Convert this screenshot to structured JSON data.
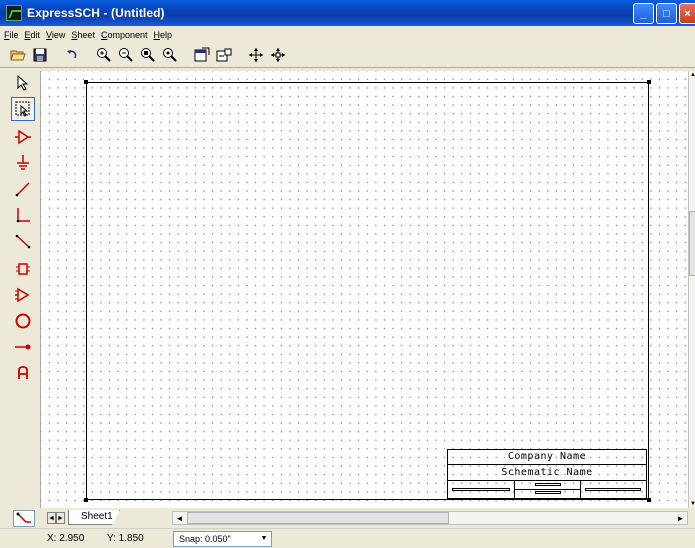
{
  "window": {
    "title": "ExpressSCH - (Untitled)",
    "minimize_symbol": "_",
    "maximize_symbol": "□",
    "close_symbol": "×"
  },
  "menu": {
    "items": [
      {
        "label": "File",
        "accel": "F",
        "rest": "ile"
      },
      {
        "label": "Edit",
        "accel": "E",
        "rest": "dit"
      },
      {
        "label": "View",
        "accel": "V",
        "rest": "iew"
      },
      {
        "label": "Sheet",
        "accel": "S",
        "rest": "heet"
      },
      {
        "label": "Component",
        "accel": "C",
        "rest": "omponent"
      },
      {
        "label": "Help",
        "accel": "H",
        "rest": "elp"
      }
    ]
  },
  "toolbar": {
    "icons": [
      "open-folder-icon",
      "save-disk-icon",
      "undo-icon",
      "zoom-in-icon",
      "zoom-out-icon",
      "zoom-area-icon",
      "zoom-fit-icon",
      "properties-icon",
      "component-properties-icon",
      "pan-icon",
      "move-icon"
    ]
  },
  "palette": {
    "tools": [
      "select-arrow-icon",
      "select-area-icon",
      "gate-component-icon",
      "ground-icon",
      "wire-icon",
      "corner-wire-icon",
      "diagonal-wire-icon",
      "ic-chip-icon",
      "buffer-icon",
      "circle-icon",
      "pin-icon",
      "text-label-icon"
    ]
  },
  "sheet": {
    "title_block": {
      "company": "Company Name",
      "schematic": "Schematic Name"
    }
  },
  "tabs": {
    "sheet_tab": "Sheet1",
    "left_arrow": "◄",
    "right_arrow": "►"
  },
  "status": {
    "x": "X: 2.950",
    "y": "Y: 1.850",
    "snap": "Snap: 0.050\""
  },
  "colors": {
    "titlebar": "#0a3da8",
    "tool_red": "#d00000"
  }
}
